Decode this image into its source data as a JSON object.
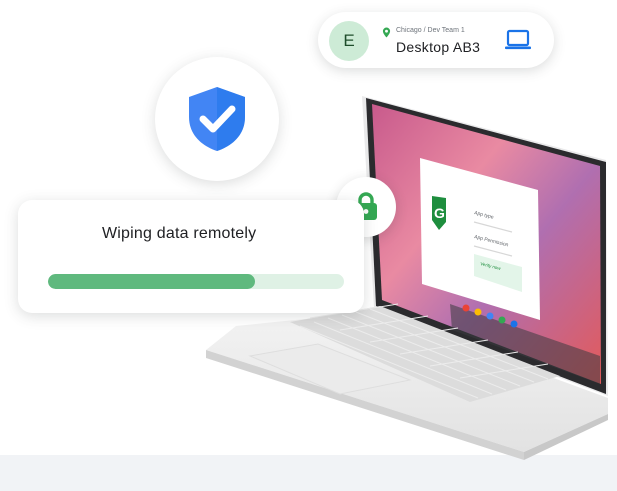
{
  "device_card": {
    "avatar_letter": "E",
    "location": "Chicago / Dev Team 1",
    "device_name": "Desktop AB3"
  },
  "wipe_card": {
    "title": "Wiping data remotely",
    "progress": 0.7
  },
  "laptop_screen": {
    "dialog_badge_letter": "G",
    "dialog_field_1": "App type",
    "dialog_field_2": "App Permission",
    "dialog_button": "Verify now"
  },
  "colors": {
    "accent_blue": "#4285f4",
    "accent_green": "#34a853",
    "progress_fill": "#5fb97e",
    "progress_track": "#dff1e5",
    "avatar_bg": "#cdebd6",
    "laptop_icon": "#1a73e8"
  },
  "icons": {
    "location": "location-pin-icon",
    "device": "laptop-icon",
    "security": "shield-check-icon",
    "lock": "lock-icon"
  }
}
